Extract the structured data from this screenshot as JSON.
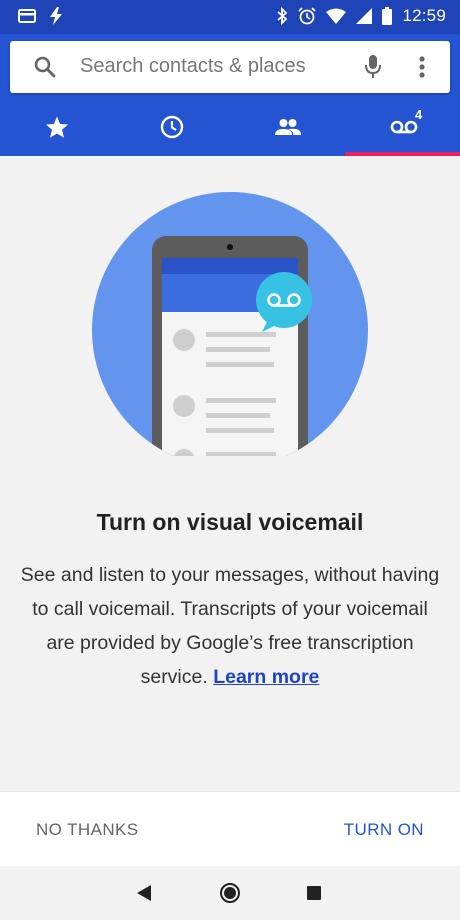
{
  "status_bar": {
    "time": "12:59",
    "icons": [
      "sim-card-icon",
      "flash-icon",
      "bluetooth-icon",
      "alarm-icon",
      "wifi-icon",
      "signal-icon",
      "battery-icon"
    ]
  },
  "search": {
    "placeholder": "Search contacts & places"
  },
  "tabs": [
    {
      "name": "favorites",
      "icon": "star-icon"
    },
    {
      "name": "recents",
      "icon": "clock-icon"
    },
    {
      "name": "contacts",
      "icon": "people-icon"
    },
    {
      "name": "voicemail",
      "icon": "voicemail-icon",
      "badge": "4",
      "selected": true
    }
  ],
  "content": {
    "title": "Turn on visual voicemail",
    "description": "See and listen to your messages, without having to call voicemail. Transcripts of your voicemail are provided by Google’s free transcription service.",
    "learn_more": "Learn more"
  },
  "actions": {
    "no_thanks": "NO THANKS",
    "turn_on": "TURN ON"
  },
  "colors": {
    "primary": "#2454d2",
    "status_bar": "#1f44b8",
    "accent": "#e91e63",
    "link": "#1f45c6"
  }
}
